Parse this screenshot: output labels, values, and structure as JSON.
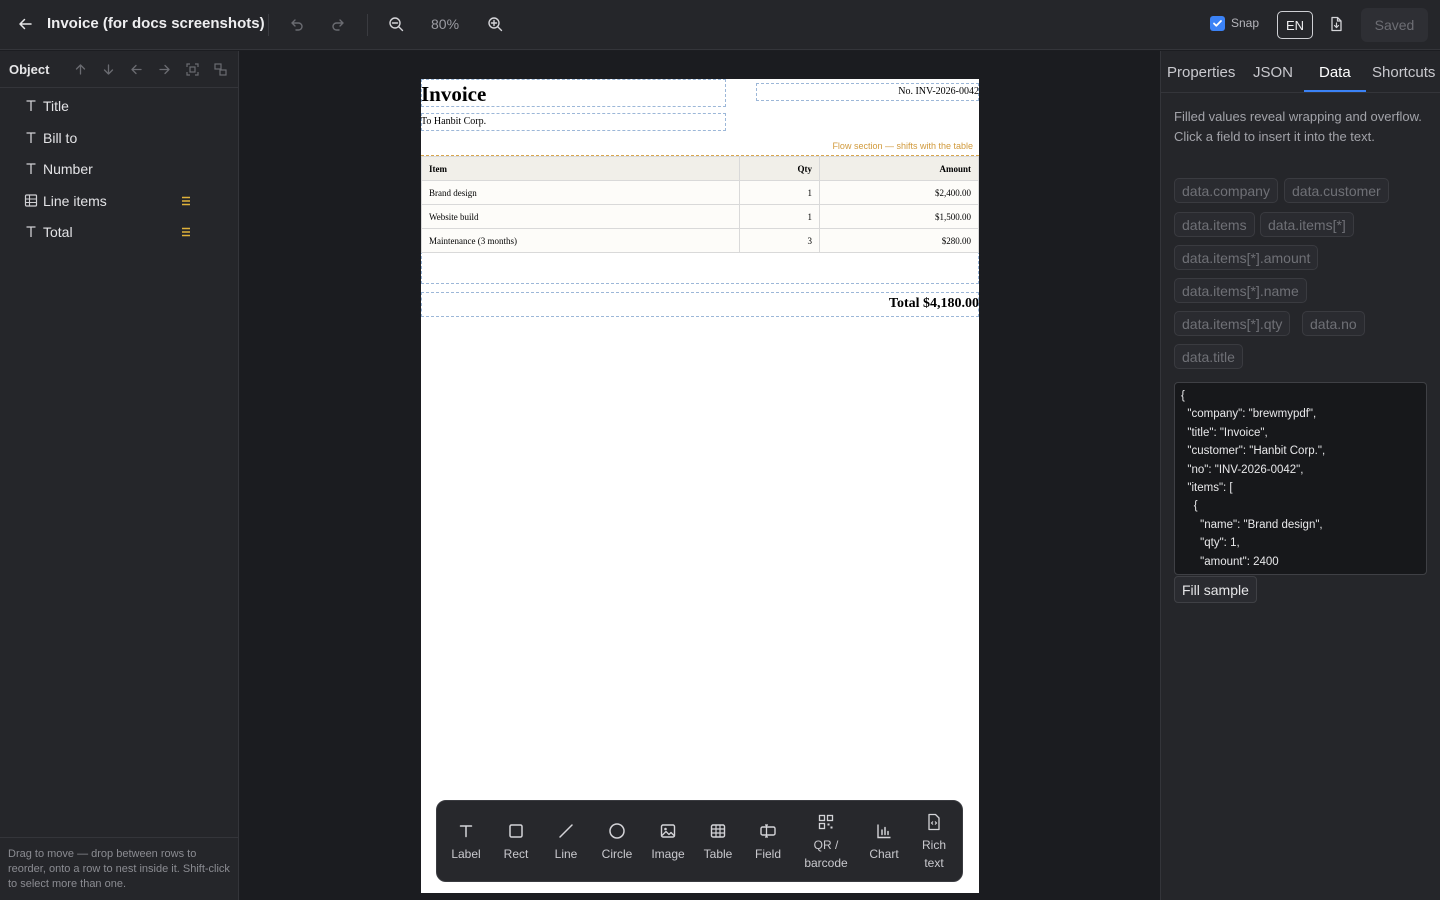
{
  "header": {
    "doc_title": "Invoice (for docs screenshots)",
    "zoom": "80%",
    "snap_label": "Snap",
    "snap_checked": true,
    "language": "EN",
    "saved_label": "Saved",
    "icons": [
      "back-arrow-icon",
      "undo-icon",
      "redo-icon",
      "zoom-out-icon",
      "zoom-in-icon",
      "check-icon",
      "pdf-export-icon"
    ]
  },
  "left_panel": {
    "title": "Object",
    "tools": [
      "move-up-icon",
      "move-down-icon",
      "outdent-icon",
      "indent-icon",
      "select-group-icon",
      "ungroup-icon"
    ],
    "objects": [
      {
        "label": "Title",
        "icon": "text-icon",
        "flow": false
      },
      {
        "label": "Bill to",
        "icon": "text-icon",
        "flow": false
      },
      {
        "label": "Number",
        "icon": "text-icon",
        "flow": false
      },
      {
        "label": "Line items",
        "icon": "table-icon",
        "flow": true
      },
      {
        "label": "Total",
        "icon": "text-icon",
        "flow": true
      }
    ],
    "footer_hint": "Drag to move — drop between rows to reorder, onto a row to nest inside it. Shift-click to select more than one."
  },
  "page": {
    "title": "Invoice",
    "number": "No. INV-2026-0042",
    "bill_to": "To Hanbit Corp.",
    "flow_note": "Flow section — shifts with the table",
    "table": {
      "headers": [
        "Item",
        "Qty",
        "Amount"
      ],
      "rows": [
        [
          "Brand design",
          "1",
          "$2,400.00"
        ],
        [
          "Website build",
          "1",
          "$1,500.00"
        ],
        [
          "Maintenance (3 months)",
          "3",
          "$280.00"
        ]
      ]
    },
    "total": "Total $4,180.00"
  },
  "toolbox": [
    {
      "label": "Label",
      "icon": "text-icon"
    },
    {
      "label": "Rect",
      "icon": "square-icon"
    },
    {
      "label": "Line",
      "icon": "line-icon"
    },
    {
      "label": "Circle",
      "icon": "circle-icon"
    },
    {
      "label": "Image",
      "icon": "image-icon"
    },
    {
      "label": "Table",
      "icon": "table-icon"
    },
    {
      "label": "Field",
      "icon": "field-icon"
    },
    {
      "label": "QR / barcode",
      "icon": "qr-icon"
    },
    {
      "label": "Chart",
      "icon": "chart-icon"
    },
    {
      "label": "Rich text",
      "icon": "rich-text-icon"
    }
  ],
  "right_panel": {
    "tabs": [
      "Properties",
      "JSON",
      "Data",
      "Shortcuts"
    ],
    "active_tab": "Data",
    "hint": "Filled values reveal wrapping and overflow. Click a field to insert it into the text.",
    "fields": [
      "data.company",
      "data.customer",
      "data.items",
      "data.items[*]",
      "data.items[*].amount",
      "data.items[*].name",
      "data.items[*].qty",
      "data.no",
      "data.title"
    ],
    "json_sample": "{\n  \"company\": \"brewmypdf\",\n  \"title\": \"Invoice\",\n  \"customer\": \"Hanbit Corp.\",\n  \"no\": \"INV-2026-0042\",\n  \"items\": [\n    {\n      \"name\": \"Brand design\",\n      \"qty\": 1,\n      \"amount\": 2400",
    "fill_button": "Fill sample"
  },
  "colors": {
    "accent": "#3b82f6",
    "flow_note": "#d19a3c",
    "flow_marker": "#e0b23a",
    "panel_bg": "#25262a",
    "canvas_bg": "#1b1c20"
  }
}
